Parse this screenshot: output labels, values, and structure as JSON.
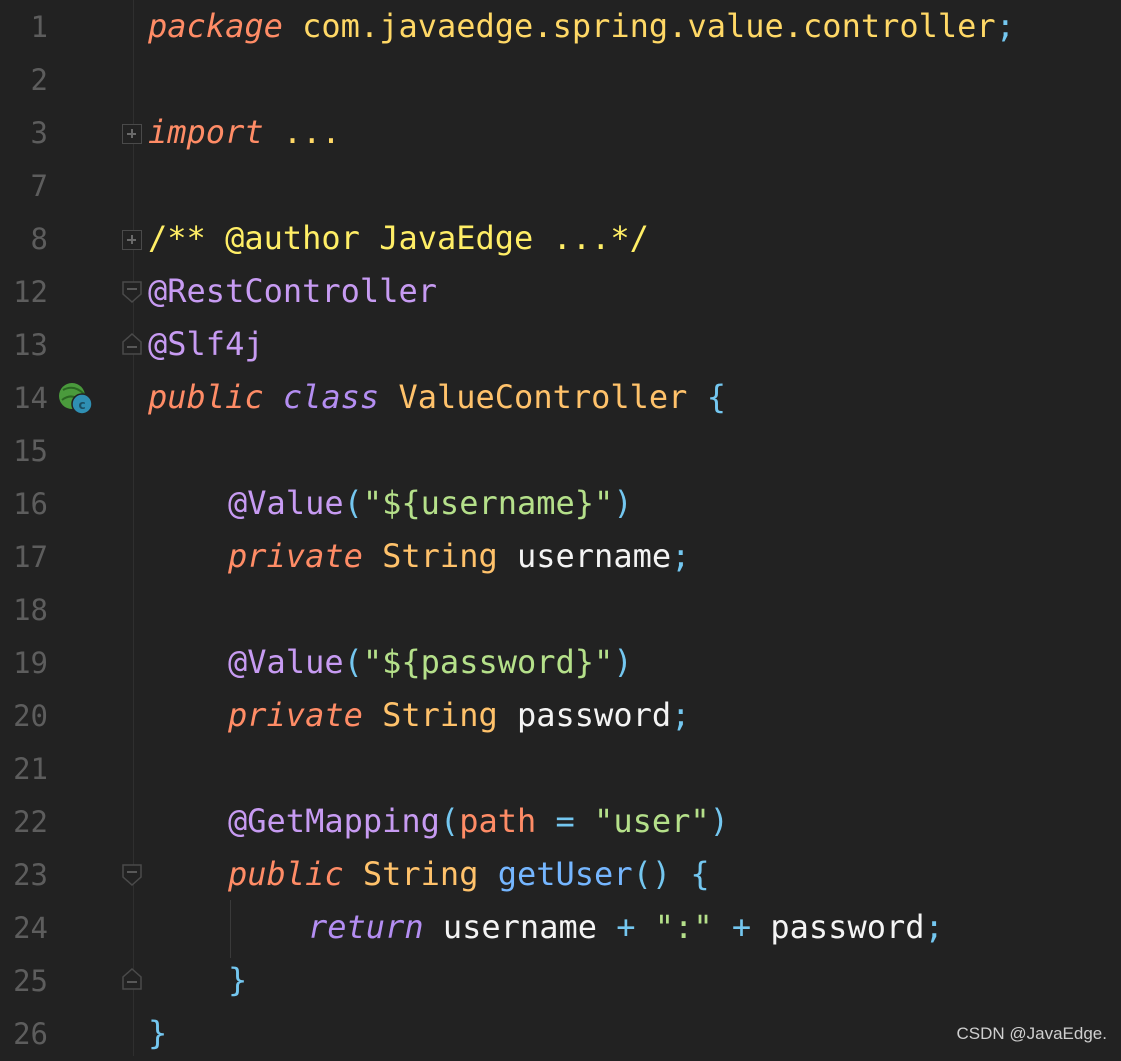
{
  "editor": {
    "line_numbers": [
      "1",
      "2",
      "3",
      "7",
      "8",
      "12",
      "13",
      "14",
      "15",
      "16",
      "17",
      "18",
      "19",
      "20",
      "21",
      "22",
      "23",
      "24",
      "25",
      "26"
    ],
    "line1": {
      "kw": "package",
      "pkg": "com.javaedge.spring.value.controller",
      "semi": ";"
    },
    "line3": {
      "kw": "import",
      "rest": "..."
    },
    "line8": {
      "doc": "/** @author JavaEdge ...*/"
    },
    "line12": {
      "ann": "@RestController"
    },
    "line13": {
      "ann": "@Slf4j"
    },
    "line14": {
      "kw1": "public",
      "kw2": "class",
      "name": "ValueController",
      "brace": "{"
    },
    "line16": {
      "ann": "@Value",
      "open": "(",
      "str": "\"${username}\"",
      "close": ")"
    },
    "line17": {
      "kw": "private",
      "type": "String",
      "ident": "username",
      "semi": ";"
    },
    "line19": {
      "ann": "@Value",
      "open": "(",
      "str": "\"${password}\"",
      "close": ")"
    },
    "line20": {
      "kw": "private",
      "type": "String",
      "ident": "password",
      "semi": ";"
    },
    "line22": {
      "ann": "@GetMapping",
      "open": "(",
      "param": "path",
      "eq": "=",
      "str": "\"user\"",
      "close": ")"
    },
    "line23": {
      "kw": "public",
      "type": "String",
      "method": "getUser",
      "parens": "()",
      "brace": "{"
    },
    "line24": {
      "kw": "return",
      "ident1": "username",
      "plus1": "+",
      "str": "\":\"",
      "plus2": "+",
      "ident2": "password",
      "semi": ";"
    },
    "line25": {
      "brace": "}"
    },
    "line26": {
      "brace": "}"
    }
  },
  "icons": {
    "gutter_class_icon": "spring-bean-class-icon",
    "fold_expand": "fold-expand-icon",
    "fold_collapse": "fold-collapse-icon"
  },
  "colors": {
    "background": "#222222",
    "keyword": "#ff8c66",
    "package": "#ffd866",
    "annotation": "#c79bf2",
    "string": "#b5e08a",
    "type": "#ffc26b",
    "method": "#75b6ff",
    "punctuation": "#74c7f0"
  },
  "watermark": "CSDN @JavaEdge."
}
